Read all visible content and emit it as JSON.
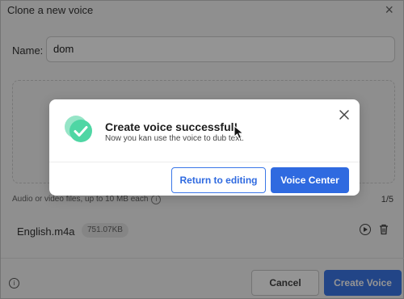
{
  "dialog": {
    "title": "Clone a new voice",
    "name_label": "Name:",
    "name_value": "dom",
    "hint": "Audio or video files, up to 10 MB each",
    "file_count": "1/5",
    "file": {
      "name": "English.m4a",
      "size": "751.07KB"
    },
    "cancel_label": "Cancel",
    "create_label": "Create Voice"
  },
  "modal": {
    "title": "Create voice successful!",
    "description": "Now you kan use the voice to dub text.",
    "return_label": "Return to editing",
    "voice_center_label": "Voice Center"
  },
  "colors": {
    "accent": "#2f6ae0",
    "success": "#3fcf99"
  },
  "icons": {
    "success": "check-circle-icon",
    "close": "close-icon",
    "play": "play-icon",
    "trash": "trash-icon",
    "info": "info-icon"
  }
}
